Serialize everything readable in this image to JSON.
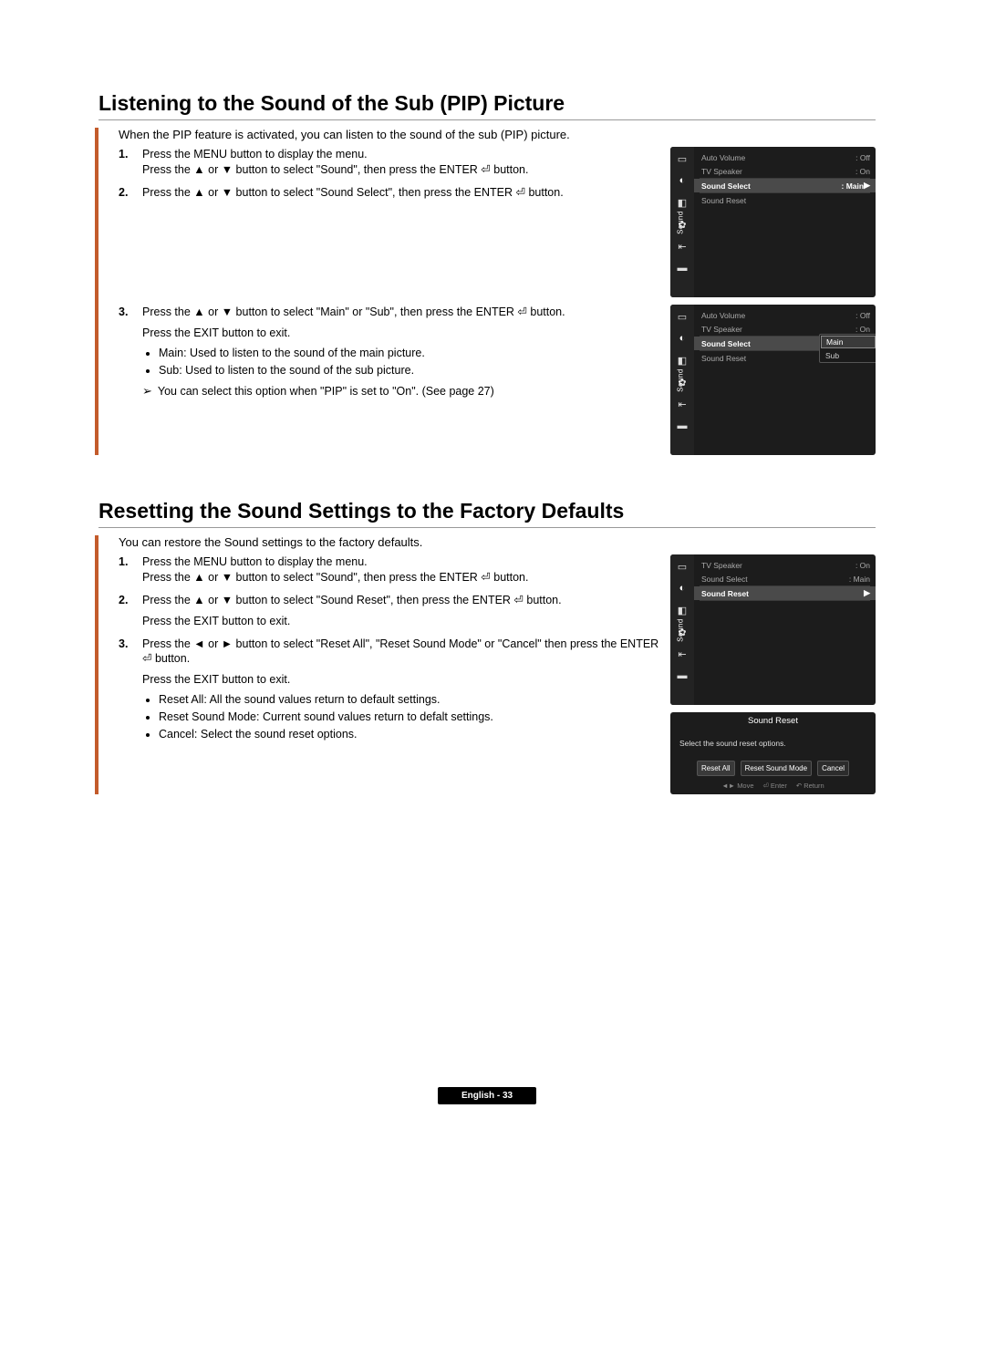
{
  "section1": {
    "title": "Listening to the Sound of the Sub (PIP) Picture",
    "intro": "When the PIP feature is activated, you can listen to the sound of the sub (PIP) picture.",
    "step1a": "Press the MENU button to display the menu.",
    "step1b": "Press the ▲ or ▼ button to select \"Sound\", then press the ENTER ⏎ button.",
    "step2": "Press the ▲ or ▼ button to select \"Sound Select\", then press the ENTER ⏎ button.",
    "step3a": "Press the ▲ or ▼ button to select \"Main\" or \"Sub\", then press the ENTER ⏎ button.",
    "step3b": "Press the EXIT button to exit.",
    "bullet_main": "Main: Used to listen to the sound of the main picture.",
    "bullet_sub": "Sub: Used to listen to the sound of the sub picture.",
    "note": "You can select this option when \"PIP\" is set to \"On\". (See page 27)"
  },
  "section2": {
    "title": "Resetting the Sound Settings to the Factory Defaults",
    "intro": "You can restore the Sound settings to the factory defaults.",
    "step1a": "Press the MENU button to display the menu.",
    "step1b": "Press the ▲ or ▼ button to select \"Sound\", then press the ENTER ⏎ button.",
    "step2a": "Press the ▲ or ▼ button to select \"Sound Reset\", then press the ENTER ⏎ button.",
    "step2b": "Press the EXIT button to exit.",
    "step3a": "Press the ◄ or ► button to select \"Reset All\", \"Reset Sound Mode\" or \"Cancel\" then press the ENTER ⏎ button.",
    "step3b": "Press the EXIT button to exit.",
    "bullet_resetall": "Reset All: All the sound values return to default settings.",
    "bullet_resetmode": "Reset Sound Mode: Current sound values return to defalt settings.",
    "bullet_cancel": "Cancel: Select the sound reset options."
  },
  "osd": {
    "category": "Sound",
    "rows": {
      "autoVolume": "Auto Volume",
      "tvSpeaker": "TV Speaker",
      "soundSelect": "Sound Select",
      "soundReset": "Sound Reset"
    },
    "vals": {
      "off": ": Off",
      "on": ": On",
      "main": ": Main"
    },
    "dropdown": {
      "main": "Main",
      "sub": "Sub"
    }
  },
  "dialog": {
    "title": "Sound Reset",
    "prompt": "Select the sound reset options.",
    "resetAll": "Reset All",
    "resetMode": "Reset Sound Mode",
    "cancel": "Cancel",
    "hints": {
      "move": "Move",
      "enter": "Enter",
      "return": "Return"
    }
  },
  "numbers": {
    "n1": "1.",
    "n2": "2.",
    "n3": "3."
  },
  "icons": {
    "arrow": "➢",
    "chev": "▶"
  },
  "footer": "English - 33"
}
